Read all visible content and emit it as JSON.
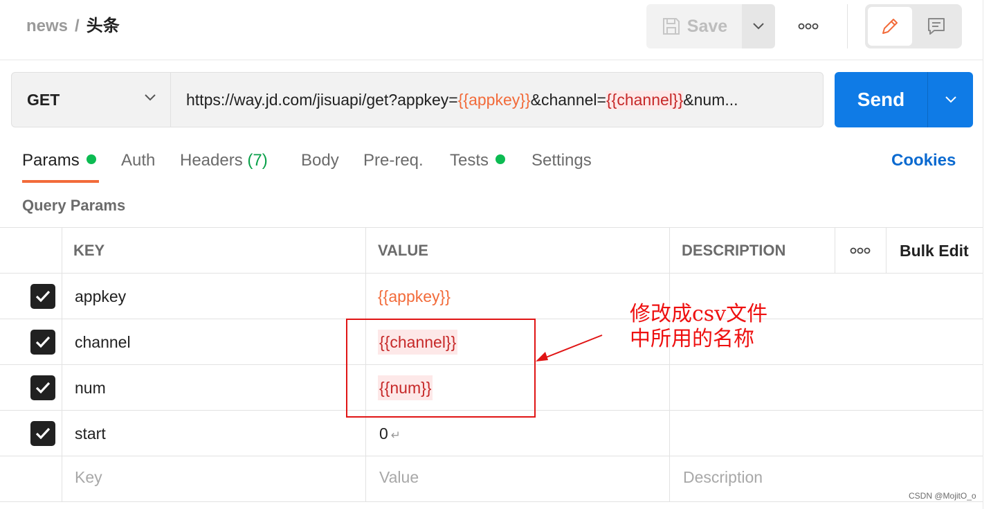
{
  "breadcrumb": {
    "collection": "news",
    "separator": "/",
    "request": "头条"
  },
  "toolbar": {
    "save_label": "Save"
  },
  "request": {
    "method": "GET",
    "url_parts": [
      {
        "text": "https://way.jd.com/jisuapi/get?appkey=",
        "kind": "text"
      },
      {
        "text": "{{appkey}}",
        "kind": "var-ok"
      },
      {
        "text": "&channel=",
        "kind": "text"
      },
      {
        "text": "{{channel}}",
        "kind": "var-bad"
      },
      {
        "text": "&num...",
        "kind": "text"
      }
    ],
    "send_label": "Send"
  },
  "tabs": [
    {
      "label": "Params",
      "active": true,
      "dot": true
    },
    {
      "label": "Auth"
    },
    {
      "label": "Headers",
      "count": "(7)"
    },
    {
      "label": "Body"
    },
    {
      "label": "Pre-req."
    },
    {
      "label": "Tests",
      "dot": true
    },
    {
      "label": "Settings"
    }
  ],
  "cookies_label": "Cookies",
  "query_params": {
    "title": "Query Params",
    "headers": {
      "key": "KEY",
      "value": "VALUE",
      "description": "DESCRIPTION",
      "bulk_edit": "Bulk Edit"
    },
    "rows": [
      {
        "checked": true,
        "key": "appkey",
        "value": "{{appkey}}",
        "value_kind": "var-ok"
      },
      {
        "checked": true,
        "key": "channel",
        "value": "{{channel}}",
        "value_kind": "var-bad"
      },
      {
        "checked": true,
        "key": "num",
        "value": "{{num}}",
        "value_kind": "var-bad"
      },
      {
        "checked": true,
        "key": "start",
        "value": "0",
        "value_kind": "text",
        "enter_glyph": "↵"
      }
    ],
    "placeholders": {
      "key": "Key",
      "value": "Value",
      "description": "Description"
    }
  },
  "annotation": {
    "line1": "修改成csv文件",
    "line2": "中所用的名称"
  },
  "watermark": "CSDN @MojitO_o",
  "colors": {
    "accent": "#f26b3a",
    "send": "#0f7be6",
    "annotation": "#ee1010",
    "dot": "#0cbb52"
  }
}
